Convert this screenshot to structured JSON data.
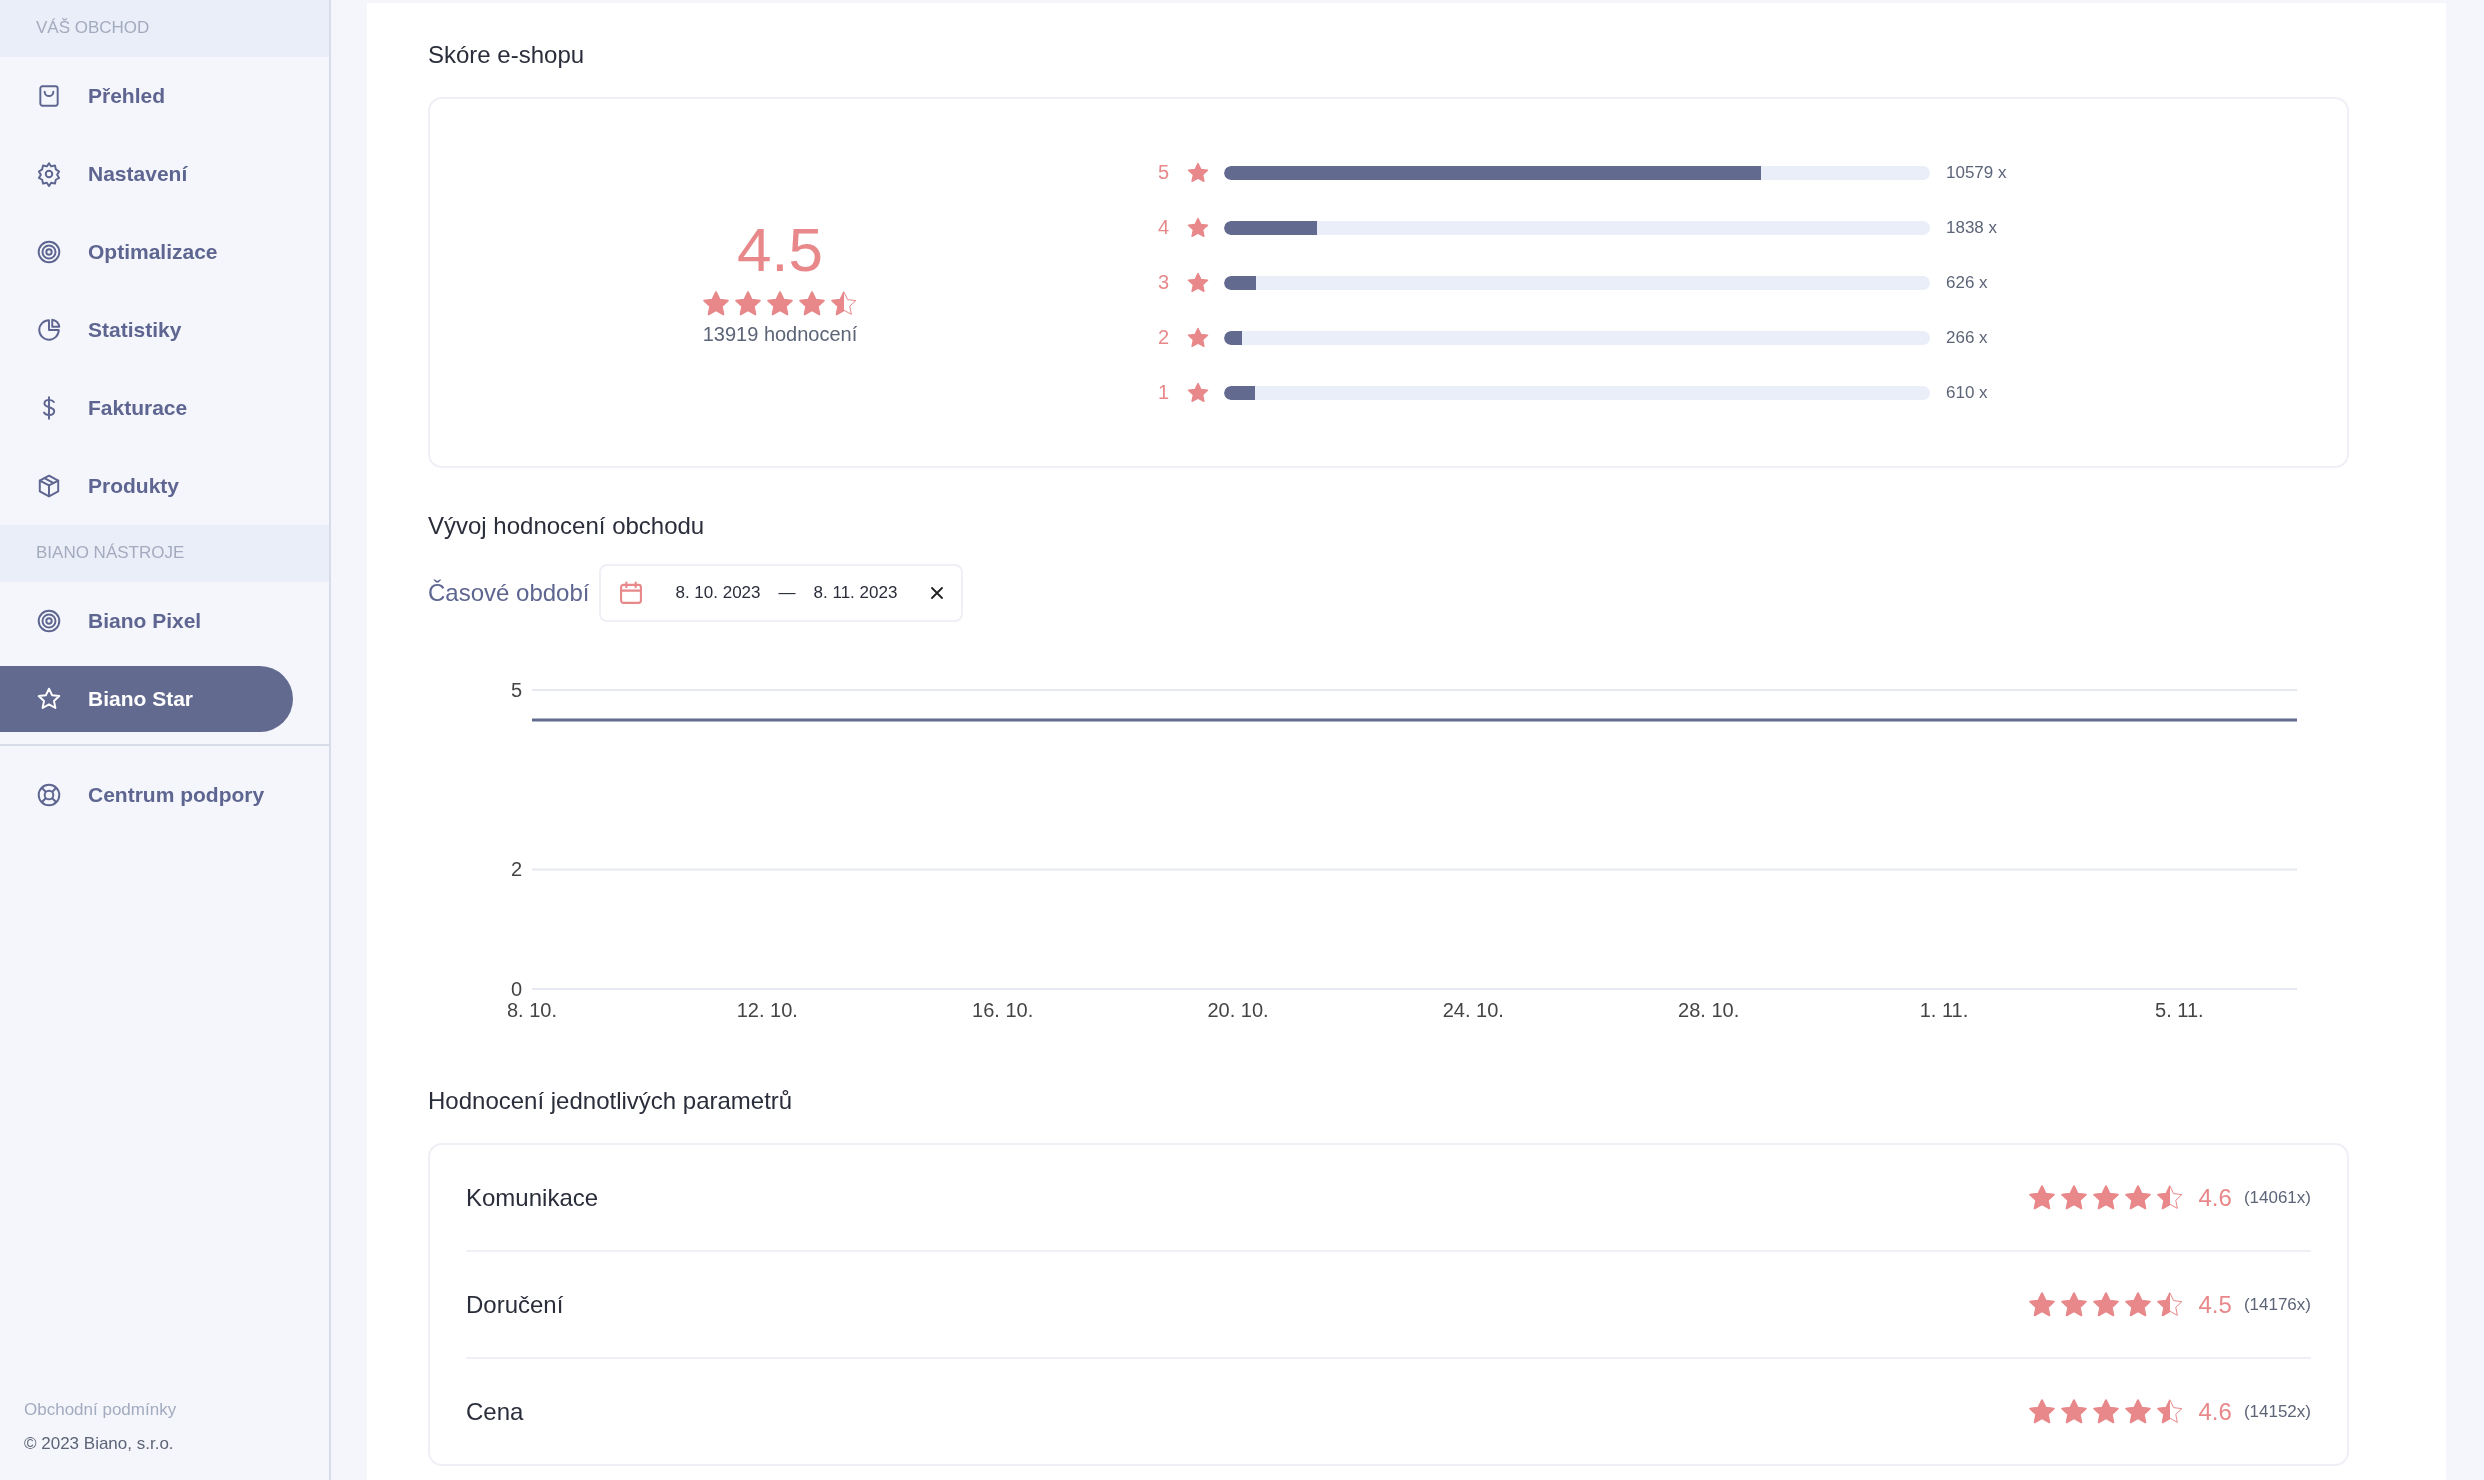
{
  "sidebar": {
    "sections": [
      {
        "heading": "VÁŠ OBCHOD",
        "items": [
          {
            "kind": "bag",
            "label": "Přehled",
            "selected": false
          },
          {
            "kind": "gear",
            "label": "Nastavení",
            "selected": false
          },
          {
            "kind": "target",
            "label": "Optimalizace",
            "selected": false
          },
          {
            "kind": "pie",
            "label": "Statistiky",
            "selected": false
          },
          {
            "kind": "dollar",
            "label": "Fakturace",
            "selected": false
          },
          {
            "kind": "box",
            "label": "Produkty",
            "selected": false
          }
        ]
      },
      {
        "heading": "BIANO NÁSTROJE",
        "items": [
          {
            "kind": "target",
            "label": "Biano Pixel",
            "selected": false
          },
          {
            "kind": "star",
            "label": "Biano Star",
            "selected": true
          }
        ]
      }
    ],
    "support": {
      "label": "Centrum podpory",
      "selected": false
    },
    "footer": {
      "link": "Obchodní podmínky",
      "copyright": "© 2023 Biano, s.r.o."
    }
  },
  "score": {
    "title": "Skóre e-shopu",
    "rating": "4.5",
    "stars": 4.5,
    "count": "13919 hodnocení",
    "distribution": [
      {
        "label": "5",
        "level": 0.76,
        "count": "10579 x"
      },
      {
        "label": "4",
        "level": 0.132,
        "count": "1838 x"
      },
      {
        "label": "3",
        "level": 0.045,
        "count": "626 x"
      },
      {
        "label": "2",
        "level": 0.025,
        "count": "266 x"
      },
      {
        "label": "1",
        "level": 0.044,
        "count": "610 x"
      }
    ]
  },
  "trend": {
    "title": "Vývoj hodnocení obchodu",
    "period_label": "Časové období",
    "date_from": "8. 10. 2023",
    "separator": "—",
    "date_to": "8. 11. 2023",
    "chart_data": {
      "type": "line",
      "categories": [
        "8. 10.",
        null,
        null,
        null,
        "12. 10.",
        null,
        null,
        null,
        "16. 10.",
        null,
        null,
        null,
        "20. 10.",
        null,
        null,
        null,
        "24. 10.",
        null,
        null,
        null,
        "28. 10.",
        null,
        null,
        null,
        "1. 11.",
        null,
        null,
        null,
        "5. 11.",
        null,
        null
      ],
      "series": [
        {
          "color": "#636a8f",
          "values": [
            4.5,
            4.5,
            4.5,
            4.5,
            4.5,
            4.5,
            4.5,
            4.5,
            4.5,
            4.5,
            4.5,
            4.5,
            4.5,
            4.5,
            4.5,
            4.5,
            4.5,
            4.5,
            4.5,
            4.5,
            4.5,
            4.5,
            4.5,
            4.5,
            4.5,
            4.5,
            4.5,
            4.5,
            4.5,
            4.5,
            4.5
          ]
        }
      ],
      "ylim": [
        0,
        5
      ],
      "yticks": [
        0,
        2,
        5
      ]
    }
  },
  "params": {
    "title": "Hodnocení jednotlivých parametrů",
    "items": [
      {
        "name": "Komunikace",
        "stars": 4.5,
        "rating": "4.6",
        "count": "(14061x)"
      },
      {
        "name": "Doručení",
        "stars": 4.5,
        "rating": "4.5",
        "count": "(14176x)"
      },
      {
        "name": "Cena",
        "stars": 4.5,
        "rating": "4.6",
        "count": "(14152x)"
      }
    ]
  }
}
